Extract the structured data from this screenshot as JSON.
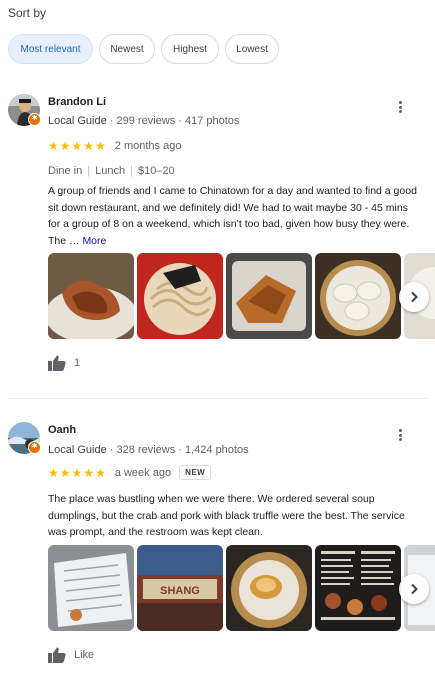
{
  "sort": {
    "label": "Sort by",
    "options": [
      "Most relevant",
      "Newest",
      "Highest",
      "Lowest"
    ],
    "selected": "Most relevant"
  },
  "reviews": [
    {
      "name": "Brandon Li",
      "guide": "Local Guide",
      "stats": "299 reviews · 417 photos",
      "rating": 5,
      "stars": "★★★★★",
      "time": "2 months ago",
      "details": [
        "Dine in",
        "Lunch",
        "$10–20"
      ],
      "text": "A group of friends and I came to Chinatown for a day and wanted to find a good sit down restaurant, and we definitely did! We had to wait maybe 30 - 45 mins for a group of 8 on a weekend, which isn’t too bad, given how busy they were. The …",
      "more": "More",
      "like_count": "1",
      "photos": [
        "fried-chicken-wings-photo",
        "noodles-bowl-photo",
        "scallion-pancake-photo",
        "dumplings-steamer-photo",
        "dumplings-partial-photo"
      ]
    },
    {
      "name": "Oanh",
      "guide": "Local Guide",
      "stats": "328 reviews · 1,424 photos",
      "rating": 5,
      "stars": "★★★★★",
      "time": "a week ago",
      "new_badge": "NEW",
      "text": "The place was bustling when we were there. We ordered several soup dumplings, but the crab and pork with black truffle were the best. The service was prompt, and the restroom was kept clean.",
      "like_label": "Like",
      "photos": [
        "menu-photo",
        "storefront-sign-photo",
        "soup-dumplings-photo",
        "menu-board-photo",
        "menu-partial-photo"
      ]
    }
  ],
  "colors": {
    "accent": "#1967d2",
    "star": "#fbbc04",
    "guide_badge": "#e8710a"
  }
}
